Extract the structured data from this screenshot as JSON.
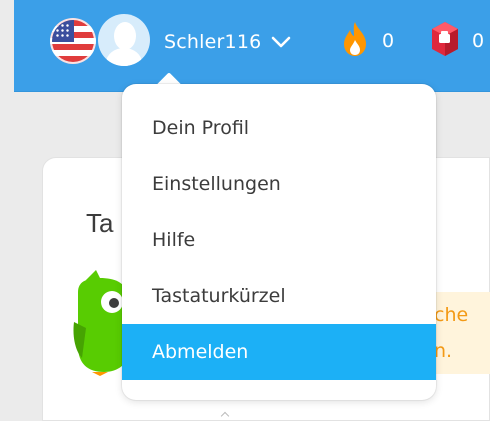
{
  "header": {
    "language_flag": "us-flag-icon",
    "avatar": "default-avatar-icon",
    "username": "Schler116",
    "streak": {
      "icon": "fire-icon",
      "count": "0"
    },
    "gems": {
      "icon": "gem-icon",
      "count": "0"
    }
  },
  "card": {
    "title": "Ta",
    "tip_fragments": [
      "che",
      "n."
    ]
  },
  "menu": {
    "items": [
      {
        "label": "Dein Profil"
      },
      {
        "label": "Einstellungen"
      },
      {
        "label": "Hilfe"
      },
      {
        "label": "Tastaturkürzel"
      },
      {
        "label": "Abmelden",
        "highlighted": true
      }
    ]
  },
  "colors": {
    "header_bg": "#3b9fe8",
    "highlight": "#1cb0f6",
    "streak": "#ff9600",
    "gem": "#e0283c",
    "tip_text": "#f39a16",
    "owl": "#58cc02"
  }
}
